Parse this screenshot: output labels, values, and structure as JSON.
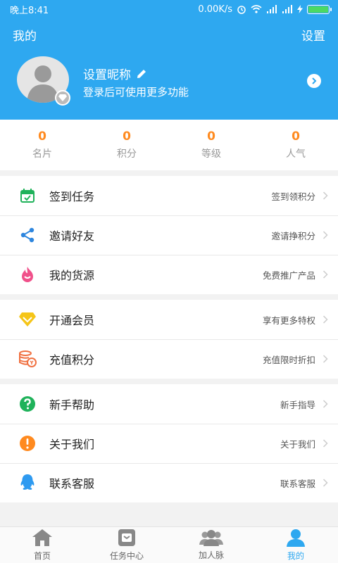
{
  "status_bar": {
    "time": "晚上8:41",
    "speed": "0.00K/s"
  },
  "header": {
    "title": "我的",
    "settings": "设置"
  },
  "profile": {
    "nickname": "设置昵称",
    "subtitle": "登录后可使用更多功能"
  },
  "stats": [
    {
      "value": "0",
      "label": "名片"
    },
    {
      "value": "0",
      "label": "积分"
    },
    {
      "value": "0",
      "label": "等级"
    },
    {
      "value": "0",
      "label": "人气"
    }
  ],
  "menu_groups": [
    [
      {
        "title": "签到任务",
        "hint": "签到领积分",
        "icon": "calendar-check-icon",
        "color": "#1fb25a"
      },
      {
        "title": "邀请好友",
        "hint": "邀请挣积分",
        "icon": "share-icon",
        "color": "#2e86de"
      },
      {
        "title": "我的货源",
        "hint": "免费推广产品",
        "icon": "flame-icon",
        "color": "#f0508a"
      }
    ],
    [
      {
        "title": "开通会员",
        "hint": "享有更多特权",
        "icon": "diamond-icon",
        "color": "#f5c518"
      },
      {
        "title": "充值积分",
        "hint": "充值限时折扣",
        "icon": "coins-icon",
        "color": "#f07040"
      }
    ],
    [
      {
        "title": "新手帮助",
        "hint": "新手指导",
        "icon": "question-icon",
        "color": "#1fb25a"
      },
      {
        "title": "关于我们",
        "hint": "关于我们",
        "icon": "info-icon",
        "color": "#ff8a1f"
      },
      {
        "title": "联系客服",
        "hint": "联系客服",
        "icon": "qq-icon",
        "color": "#2e9af0"
      }
    ]
  ],
  "tabbar": [
    {
      "label": "首页",
      "icon": "home-icon",
      "active": false
    },
    {
      "label": "任务中心",
      "icon": "task-icon",
      "active": false
    },
    {
      "label": "加人脉",
      "icon": "contacts-icon",
      "active": false
    },
    {
      "label": "我的",
      "icon": "user-icon",
      "active": true
    }
  ],
  "colors": {
    "primary": "#2ea8f0",
    "accent": "#ff8a1f"
  }
}
